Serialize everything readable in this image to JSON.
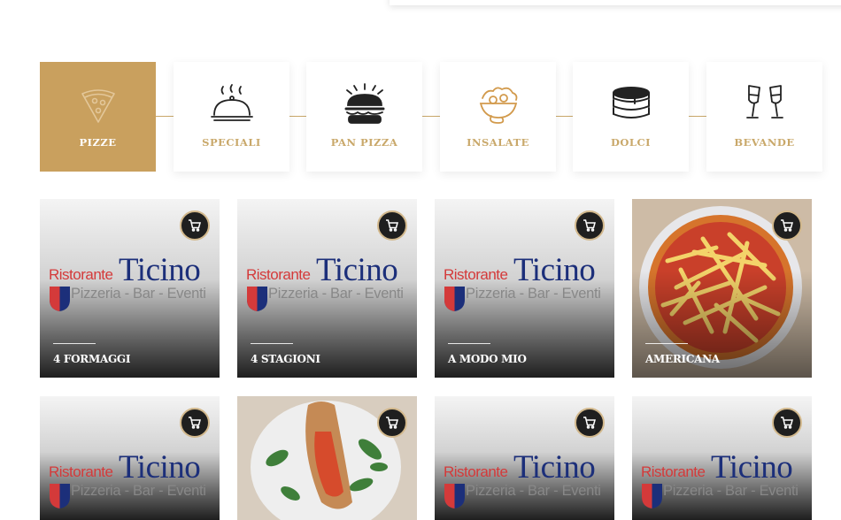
{
  "categories": [
    {
      "label": "PIZZE",
      "icon": "pizza-slice-icon",
      "active": true
    },
    {
      "label": "SPECIALI",
      "icon": "cloche-icon",
      "active": false
    },
    {
      "label": "PAN PIZZA",
      "icon": "burger-icon",
      "active": false
    },
    {
      "label": "INSALATE",
      "icon": "salad-icon",
      "active": false
    },
    {
      "label": "DOLCI",
      "icon": "pancakes-icon",
      "active": false
    },
    {
      "label": "BEVANDE",
      "icon": "champagne-glasses-icon",
      "active": false
    }
  ],
  "logo": {
    "ristorante": "Ristorante",
    "ticino": "Ticino",
    "subtitle": "Pizzeria - Bar - Eventi"
  },
  "products": [
    {
      "name": "4 FORMAGGI",
      "image": "logo-placeholder"
    },
    {
      "name": "4 STAGIONI",
      "image": "logo-placeholder"
    },
    {
      "name": "A MODO MIO",
      "image": "logo-placeholder"
    },
    {
      "name": "AMERICANA",
      "image": "pizza-fries-photo"
    },
    {
      "name": "",
      "image": "logo-placeholder"
    },
    {
      "name": "",
      "image": "calzone-photo"
    },
    {
      "name": "",
      "image": "logo-placeholder"
    },
    {
      "name": "",
      "image": "logo-placeholder"
    }
  ],
  "colors": {
    "accent_gold": "#c9a05e",
    "label_gold": "#c9a86a",
    "logo_red": "#d43a3a",
    "logo_navy": "#1c2f7a"
  }
}
